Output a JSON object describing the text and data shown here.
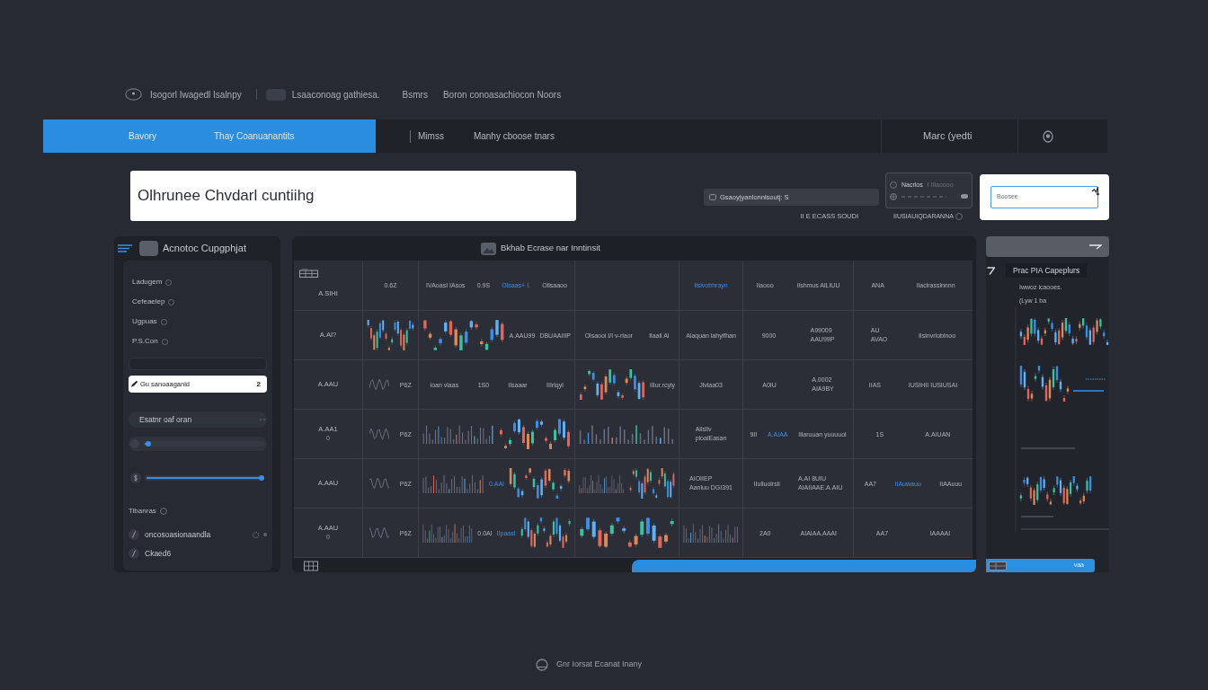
{
  "top_nav": {
    "brand": "Isogorl Iwagedl Isalnpy",
    "links": [
      "Lsaaconoag gathiesa.",
      "Bsmrs",
      "Boron conoasachiocon Noors"
    ]
  },
  "tabs": [
    {
      "label": "Bavory",
      "selected": true
    },
    {
      "label": "Thay Coanuanantits",
      "selected": true
    },
    {
      "label": "Mimss",
      "selected": false
    },
    {
      "label": "Manhy cboose tnars",
      "selected": false
    }
  ],
  "menu": {
    "label": "Marc (yedti"
  },
  "search": {
    "value": "Olhrunee Chvdarl cuntiihg"
  },
  "filter_field": {
    "value": "Gsaoy|yanlonnlsoutj: S",
    "caption": "II E ECASS SOUDI"
  },
  "info_card": {
    "title": "Nacrlos",
    "detail": "I IIlaoooo",
    "caption": "IIUSIAUIQDARANNA"
  },
  "quick_field": {
    "placeholder": "Boosee"
  },
  "left_panel": {
    "title": "Acnotoc Cupgphjat",
    "items": [
      {
        "label": "Ladugem",
        "selected": false
      },
      {
        "label": "Cefeaelep",
        "selected": false
      },
      {
        "label": "Ugpuas",
        "selected": false
      },
      {
        "label": "P.S.Con",
        "selected": false
      }
    ],
    "picker": {
      "label": "Gu sanoaaganid",
      "count": "2",
      "selected": true
    },
    "option": {
      "label": "Esatnr oaf oran"
    },
    "sliders": [
      {
        "level": 0.02
      },
      {
        "level": 1
      }
    ],
    "section": {
      "title": "Tibanras",
      "items": [
        "oncosoasionaandla",
        "Ckaed6"
      ]
    }
  },
  "main_panel": {
    "title": "Bkhab Ecrase nar Inntinsit",
    "rows": [
      {
        "label": "A.SIHI",
        "cells": [
          [
            {
              "kind": "text",
              "text": "0.6Z"
            }
          ],
          [
            {
              "kind": "text",
              "text": "IVAoasI IAsos"
            },
            {
              "kind": "text",
              "text": "0.9S"
            },
            {
              "kind": "accent",
              "text": "Olsaas+ I."
            },
            {
              "kind": "text",
              "text": "Ollsaaoo"
            }
          ],
          [],
          [
            {
              "kind": "accent",
              "text": "Ilslvobhrayn"
            }
          ],
          [
            {
              "kind": "text",
              "text": "Iiaooo"
            },
            {
              "kind": "text",
              "text": "Ilshmus AlLIUU"
            }
          ],
          [
            {
              "kind": "text",
              "text": "ANA"
            },
            {
              "kind": "text",
              "text": "Ilaclrasslnnnn"
            }
          ]
        ]
      },
      {
        "label": "A.AI?",
        "cells": [
          [
            {
              "kind": "candles"
            }
          ],
          [
            {
              "kind": "candles"
            },
            {
              "kind": "text",
              "text": "A.AAU99"
            },
            {
              "kind": "text",
              "text": "DBUAAIIIP"
            }
          ],
          [
            {
              "kind": "text",
              "text": "Olsaooi I/I v-rlaor"
            },
            {
              "kind": "text",
              "text": "Ilaali Al"
            }
          ],
          [
            {
              "kind": "text",
              "text": "Alaquan lahylfhan"
            }
          ],
          [
            {
              "kind": "text",
              "text": "9000"
            },
            {
              "kind": "stack",
              "lines": [
                "A99009",
                "AAU99P"
              ]
            }
          ],
          [
            {
              "kind": "stack",
              "lines": [
                "AU",
                "AVAO"
              ]
            },
            {
              "kind": "text",
              "text": "IIslnvrloblnoo"
            }
          ]
        ]
      },
      {
        "label": "A.AAU",
        "cells": [
          [
            {
              "kind": "sparkline"
            },
            {
              "kind": "text",
              "text": "P6Z"
            }
          ],
          [
            {
              "kind": "text",
              "text": "Ioan vlaas"
            },
            {
              "kind": "text",
              "text": "1S0"
            },
            {
              "kind": "text",
              "text": "Ilsaaar"
            },
            {
              "kind": "text",
              "text": "IIIrlqyl"
            }
          ],
          [
            {
              "kind": "candles"
            },
            {
              "kind": "text",
              "text": "IIIur.rcyly"
            }
          ],
          [
            {
              "kind": "text",
              "text": "Jlvlaa03"
            }
          ],
          [
            {
              "kind": "text",
              "text": "A0IU"
            },
            {
              "kind": "stack",
              "lines": [
                "A.0002",
                "AIA9BY"
              ]
            }
          ],
          [
            {
              "kind": "text",
              "text": "IIAS"
            },
            {
              "kind": "text",
              "text": "IUSIHII IUSIUSAI"
            }
          ]
        ]
      },
      {
        "label": "A.AA1",
        "note": "0",
        "cells": [
          [
            {
              "kind": "sparkline"
            },
            {
              "kind": "text",
              "text": "P6Z"
            }
          ],
          [
            {
              "kind": "bars"
            },
            {
              "kind": "candles"
            }
          ],
          [
            {
              "kind": "bars"
            }
          ],
          [
            {
              "kind": "stack",
              "lines": [
                "Ailsliv",
                "ploalEasan"
              ]
            }
          ],
          [
            {
              "kind": "text",
              "text": "9II"
            },
            {
              "kind": "accent",
              "text": "A.AIAA"
            },
            {
              "kind": "text",
              "text": "Illaruuan yuuuuol"
            }
          ],
          [
            {
              "kind": "text",
              "text": "1S"
            },
            {
              "kind": "text",
              "text": "A.AIUAN"
            }
          ]
        ]
      },
      {
        "label": "A.AAU",
        "cells": [
          [
            {
              "kind": "sparkline"
            },
            {
              "kind": "text",
              "text": "P6Z"
            }
          ],
          [
            {
              "kind": "bars"
            },
            {
              "kind": "accent",
              "text": "0.AAI"
            },
            {
              "kind": "candles"
            }
          ],
          [
            {
              "kind": "bars"
            },
            {
              "kind": "candles"
            }
          ],
          [
            {
              "kind": "stack",
              "lines": [
                "AIOIIEP",
                "Aanluu DGI391"
              ]
            }
          ],
          [
            {
              "kind": "text",
              "text": "IIulluolrsii"
            },
            {
              "kind": "stack",
              "lines": [
                "A.AI 8UIU",
                "AIAIIAAE.A.AIU"
              ]
            }
          ],
          [
            {
              "kind": "text",
              "text": "AA7"
            },
            {
              "kind": "accent",
              "text": "IIAuwauu"
            },
            {
              "kind": "text",
              "text": "IIAAuuu"
            }
          ]
        ]
      },
      {
        "label": "A.AAU",
        "note": "0",
        "cells": [
          [
            {
              "kind": "sparkline"
            },
            {
              "kind": "text",
              "text": "P6Z"
            }
          ],
          [
            {
              "kind": "bars"
            },
            {
              "kind": "text",
              "text": "0.0AI"
            },
            {
              "kind": "accent",
              "text": "IIpaasI"
            },
            {
              "kind": "candles"
            }
          ],
          [
            {
              "kind": "candles"
            }
          ],
          [
            {
              "kind": "bars"
            }
          ],
          [
            {
              "kind": "text",
              "text": "2A0"
            },
            {
              "kind": "text",
              "text": "AIAIAA.AAAI"
            }
          ],
          [
            {
              "kind": "text",
              "text": "AA7"
            },
            {
              "kind": "text",
              "text": "IAAAAI"
            }
          ]
        ]
      }
    ]
  },
  "right_panel": {
    "title": "Prac PIA Capeplurs",
    "lines": [
      "Iwwoz icaooes.",
      "(Lyw 1 ba"
    ],
    "button": "vaa"
  },
  "footer": {
    "text": "Gnr Iorsat Ecanat Inany"
  }
}
